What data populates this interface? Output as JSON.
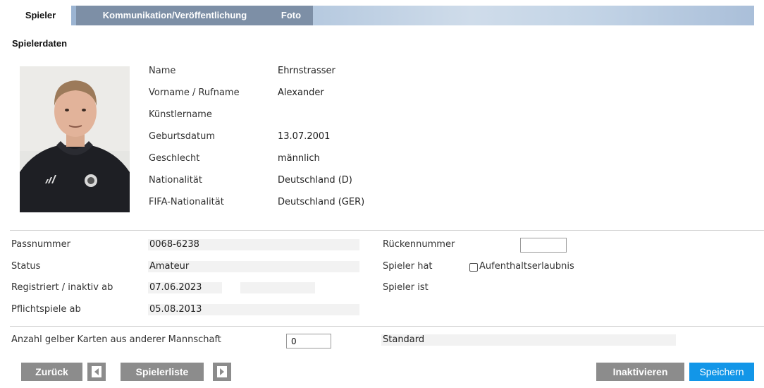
{
  "tabs": [
    {
      "label": "Spieler"
    },
    {
      "label": "Kommunikation/Veröffentlichung"
    },
    {
      "label": "Foto"
    }
  ],
  "section_title": "Spielerdaten",
  "player": {
    "name_label": "Name",
    "name": "Ehrnstrasser",
    "vorname_label": "Vorname / Rufname",
    "vorname": "Alexander",
    "kuenstlername_label": "Künstlername",
    "kuenstlername": "",
    "geburtsdatum_label": "Geburtsdatum",
    "geburtsdatum": "13.07.2001",
    "geschlecht_label": "Geschlecht",
    "geschlecht": "männlich",
    "nationalitaet_label": "Nationalität",
    "nationalitaet": "Deutschland (D)",
    "fifa_label": "FIFA-Nationalität",
    "fifa": "Deutschland (GER)"
  },
  "pass": {
    "passnummer_label": "Passnummer",
    "passnummer": "0068-6238",
    "status_label": "Status",
    "status": "Amateur",
    "registriert_label": "Registriert / inaktiv ab",
    "registriert": "07.06.2023",
    "inaktiv": "",
    "pflichtspiele_label": "Pflichtspiele ab",
    "pflichtspiele": "05.08.2013",
    "rueckennummer_label": "Rückennummer",
    "rueckennummer": "",
    "spieler_hat_label": "Spieler hat",
    "aufenthalt_label": "Aufenthaltserlaubnis",
    "spieler_ist_label": "Spieler ist"
  },
  "cards": {
    "label": "Anzahl gelber Karten aus anderer Mannschaft",
    "value": "0",
    "standard_label": "Standard"
  },
  "buttons": {
    "back": "Zurück",
    "list": "Spielerliste",
    "deactivate": "Inaktivieren",
    "save": "Speichern"
  }
}
